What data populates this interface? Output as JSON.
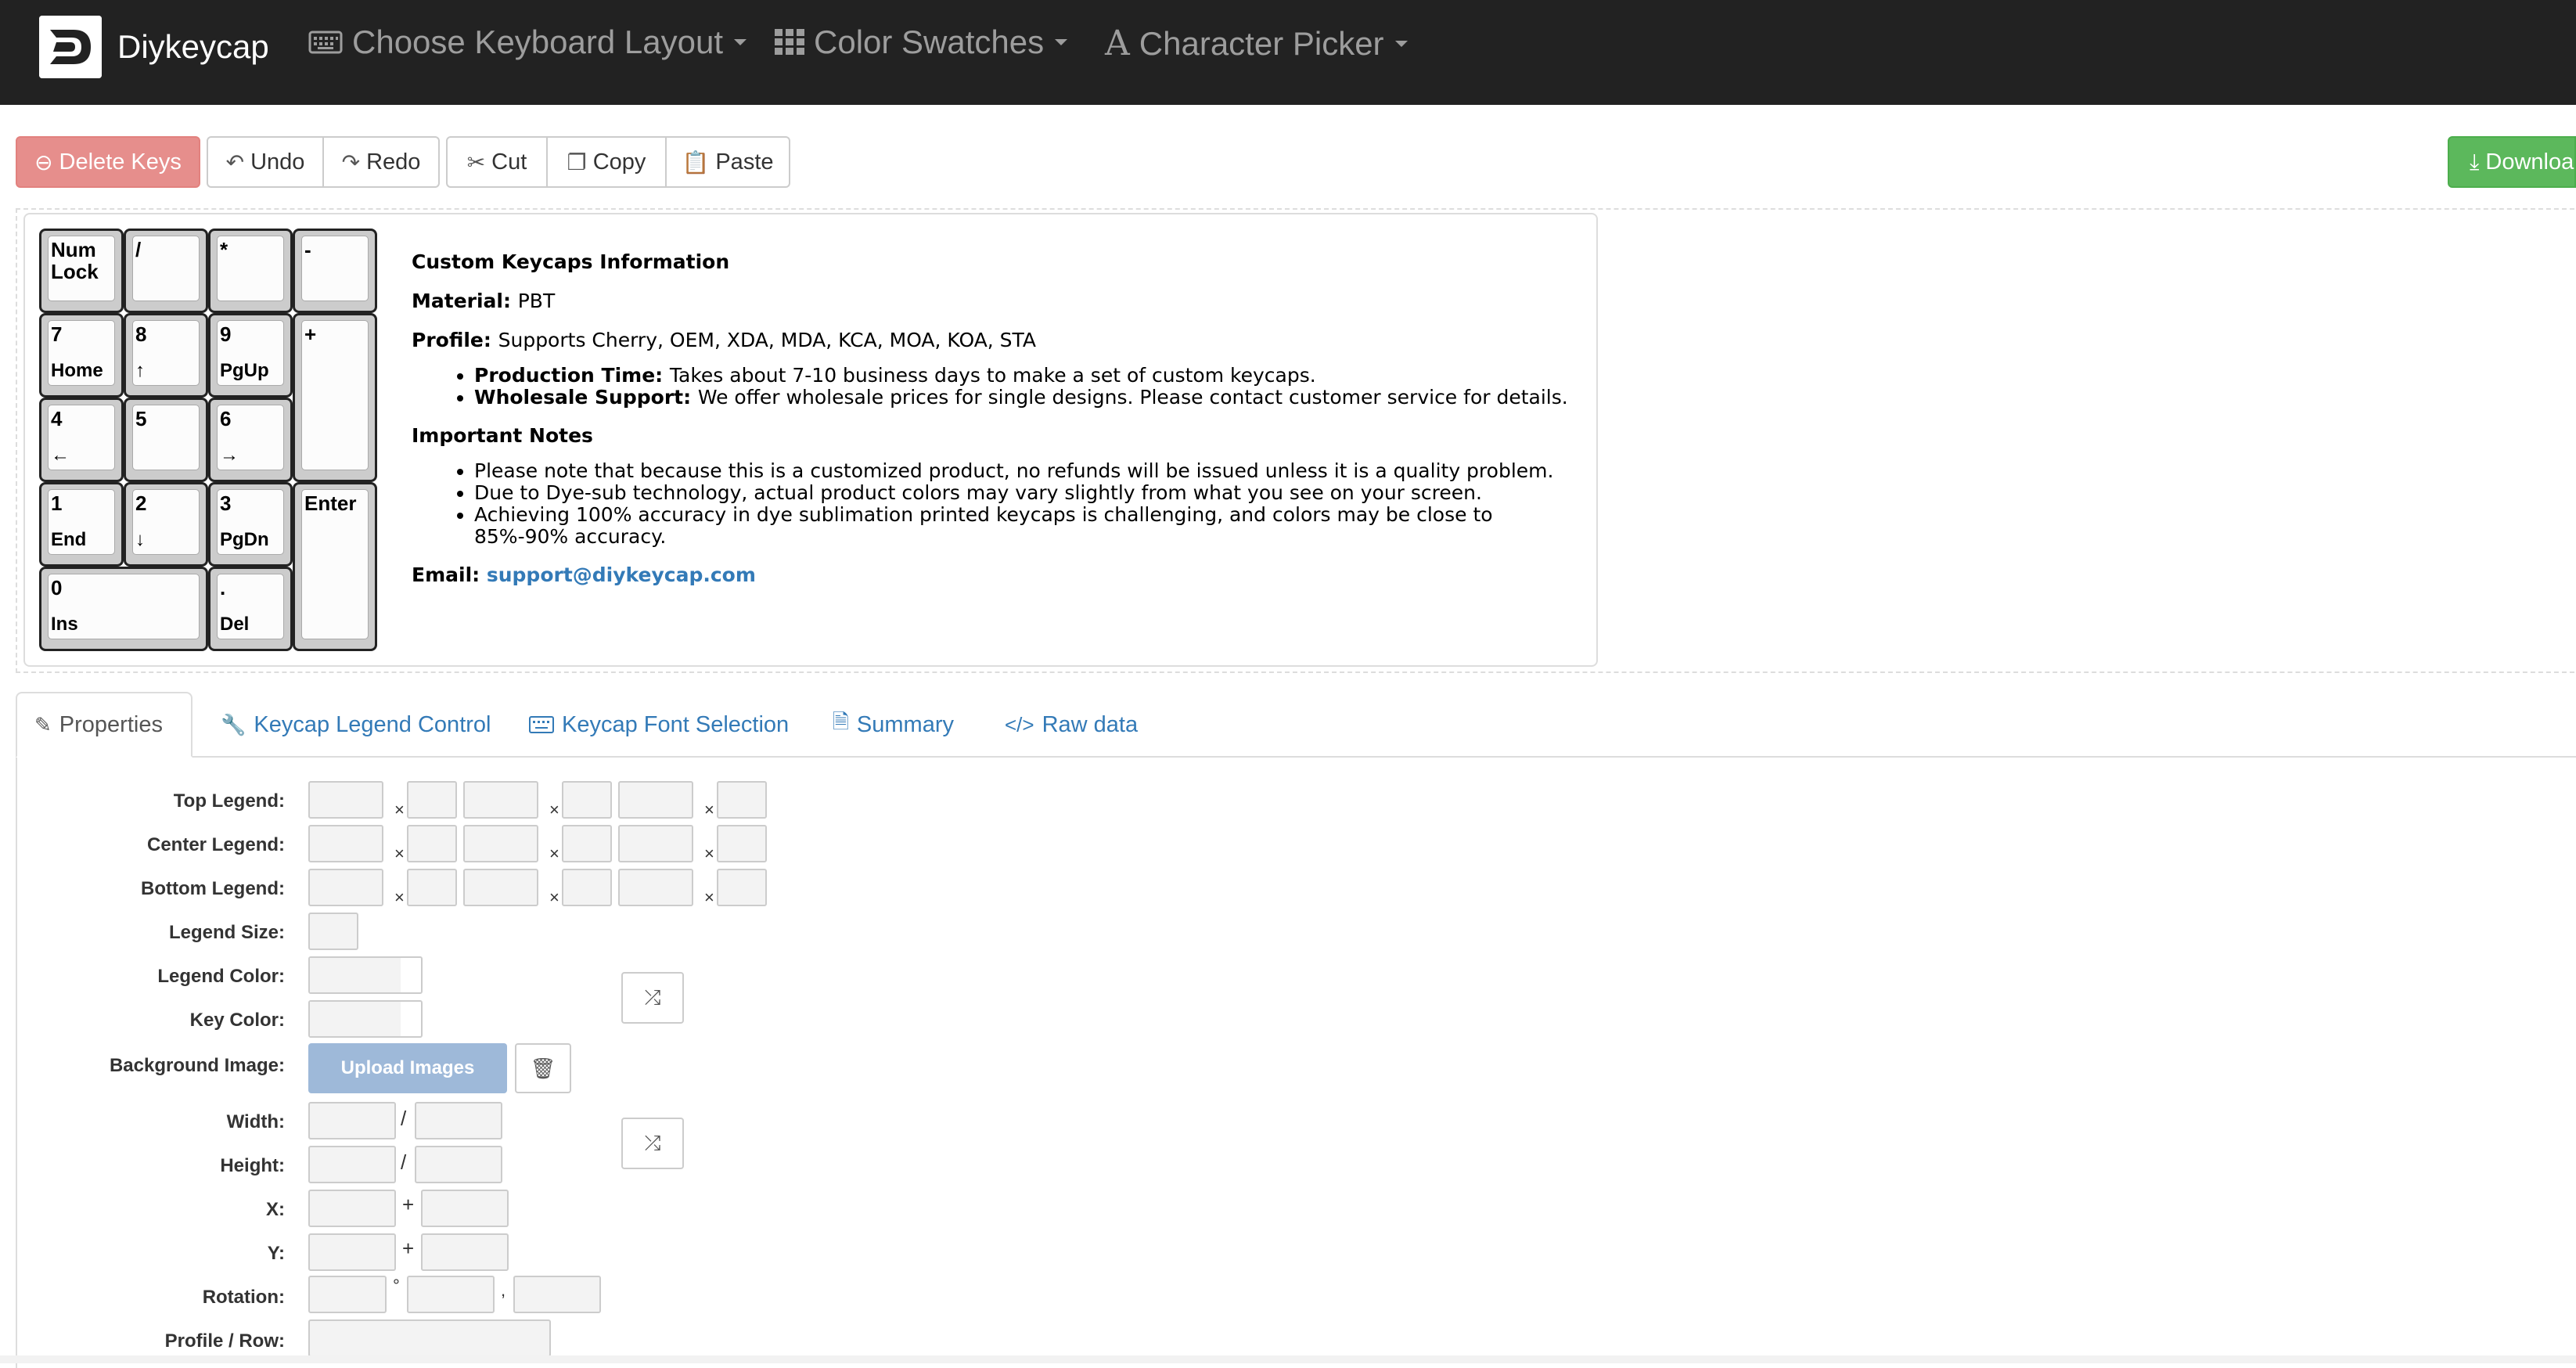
{
  "brand": {
    "name": "Diykeycap"
  },
  "nav": {
    "layout": "Choose Keyboard Layout",
    "swatches": "Color Swatches",
    "picker": "Character Picker"
  },
  "toolbar": {
    "delete": "Delete Keys",
    "undo": "Undo",
    "redo": "Redo",
    "cut": "Cut",
    "copy": "Copy",
    "paste": "Paste",
    "download": "Downloa"
  },
  "keys": [
    {
      "top": "Num Lock",
      "bottom": ""
    },
    {
      "top": "/",
      "bottom": ""
    },
    {
      "top": "*",
      "bottom": ""
    },
    {
      "top": "-",
      "bottom": ""
    },
    {
      "top": "7",
      "bottom": "Home"
    },
    {
      "top": "8",
      "bottom": "↑"
    },
    {
      "top": "9",
      "bottom": "PgUp"
    },
    {
      "top": "+",
      "bottom": ""
    },
    {
      "top": "4",
      "bottom": "←"
    },
    {
      "top": "5",
      "bottom": ""
    },
    {
      "top": "6",
      "bottom": "→"
    },
    {
      "top": "1",
      "bottom": "End"
    },
    {
      "top": "2",
      "bottom": "↓"
    },
    {
      "top": "3",
      "bottom": "PgDn"
    },
    {
      "top": "Enter",
      "bottom": ""
    },
    {
      "top": "0",
      "bottom": "Ins"
    },
    {
      "top": ".",
      "bottom": "Del"
    }
  ],
  "info": {
    "heading": "Custom Keycaps Information",
    "material_label": "Material:",
    "material_value": "PBT",
    "profile_label": "Profile:",
    "profile_value": "Supports Cherry, OEM, XDA, MDA, KCA, MOA, KOA, STA",
    "production_label": "Production Time:",
    "production_value": "Takes about 7-10 business days to make a set of custom keycaps.",
    "wholesale_label": "Wholesale Support:",
    "wholesale_value": "We offer wholesale prices for single designs. Please contact customer service for details.",
    "notes_heading": "Important Notes",
    "note1": "Please note that because this is a customized product, no refunds will be issued unless it is a quality problem.",
    "note2": "Due to Dye-sub technology, actual product colors may vary slightly from what you see on your screen.",
    "note3": "Achieving 100% accuracy in dye sublimation printed keycaps is challenging, and colors may be close to 85%-90% accuracy.",
    "email_label": "Email:",
    "email_value": "support@diykeycap.com"
  },
  "tabs": {
    "properties": "Properties",
    "legend_control": "Keycap Legend Control",
    "font_selection": "Keycap Font Selection",
    "summary": "Summary",
    "raw": "Raw data"
  },
  "form": {
    "top_legend": "Top Legend:",
    "center_legend": "Center Legend:",
    "bottom_legend": "Bottom Legend:",
    "legend_size": "Legend Size:",
    "legend_color": "Legend Color:",
    "key_color": "Key Color:",
    "background_image": "Background Image:",
    "upload": "Upload Images",
    "width": "Width:",
    "height": "Height:",
    "x": "X:",
    "y": "Y:",
    "rotation": "Rotation:",
    "profile_row": "Profile / Row:",
    "times": "×",
    "slash": "/",
    "plus": "+",
    "degree": "°",
    "comma": ","
  }
}
